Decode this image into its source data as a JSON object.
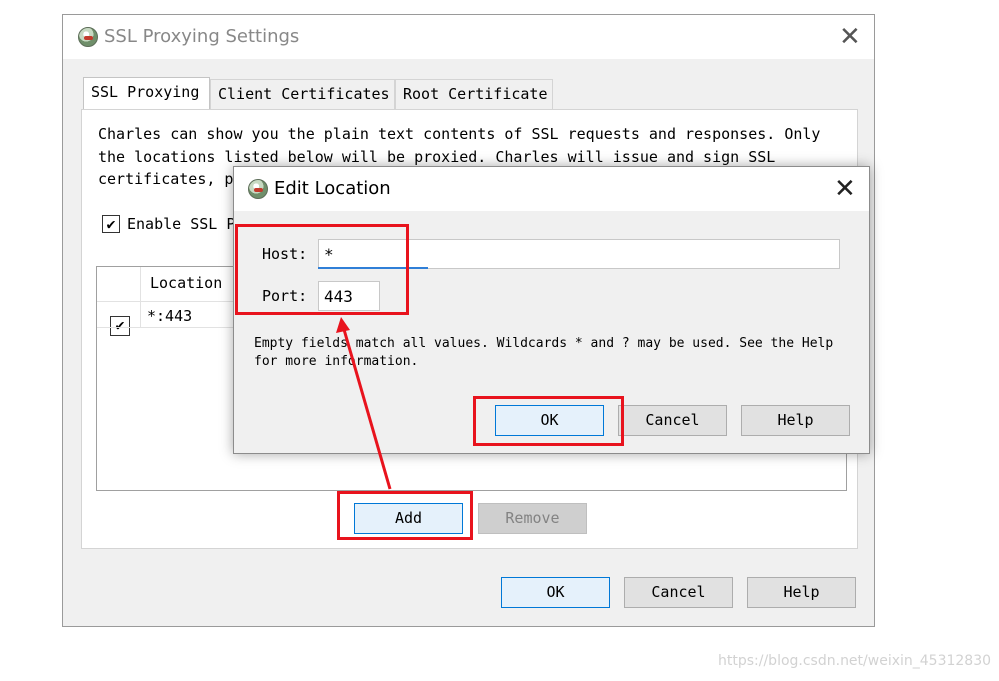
{
  "main_window": {
    "title": "SSL Proxying Settings",
    "tabs": [
      "SSL Proxying",
      "Client Certificates",
      "Root Certificate"
    ],
    "description": "Charles can show you the plain text contents of SSL requests and responses. Only\nthe locations listed below will be proxied. Charles will issue and sign SSL\ncertificates, p",
    "enable_label": "Enable SSL P",
    "enable_checked": true,
    "table": {
      "column_location": "Location",
      "rows": [
        {
          "enabled": true,
          "location": "*:443"
        }
      ]
    },
    "add_label": "Add",
    "remove_label": "Remove",
    "ok_label": "OK",
    "cancel_label": "Cancel",
    "help_label": "Help"
  },
  "dialog": {
    "title": "Edit Location",
    "host_label": "Host:",
    "host_value": "*",
    "port_label": "Port:",
    "port_value": "443",
    "help_text": "Empty fields match all values. Wildcards * and ? may be used. See the Help\nfor more information.",
    "ok_label": "OK",
    "cancel_label": "Cancel",
    "help_label": "Help"
  },
  "icons": {
    "app": "charles-vase-icon",
    "close": "close-icon",
    "check": "checkmark-icon"
  },
  "colors": {
    "annotation": "#e8131d",
    "focus": "#0078d7"
  },
  "watermark": "https://blog.csdn.net/weixin_45312830"
}
